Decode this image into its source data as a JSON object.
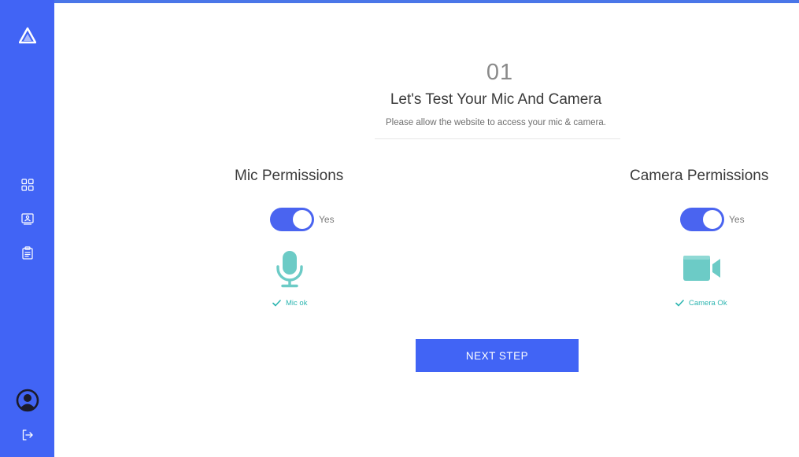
{
  "step": {
    "number": "01",
    "title": "Let's Test Your Mic And Camera",
    "subtitle": "Please allow the website to access your mic & camera."
  },
  "mic": {
    "title": "Mic Permissions",
    "toggle_label": "Yes",
    "enabled": true,
    "status": "Mic ok"
  },
  "camera": {
    "title": "Camera Permissions",
    "toggle_label": "Yes",
    "enabled": true,
    "status": "Camera Ok"
  },
  "next_button": {
    "label": "NEXT STEP"
  },
  "sidebar": {
    "icons": [
      "logo-icon",
      "dashboard-icon",
      "whiteboard-icon",
      "notes-icon",
      "user-avatar-icon",
      "logout-icon"
    ]
  },
  "colors": {
    "sidebar": "#4164f5",
    "accent": "#4a64f0",
    "teal": "#6ccbc6",
    "status_text": "#2cb5b0"
  }
}
